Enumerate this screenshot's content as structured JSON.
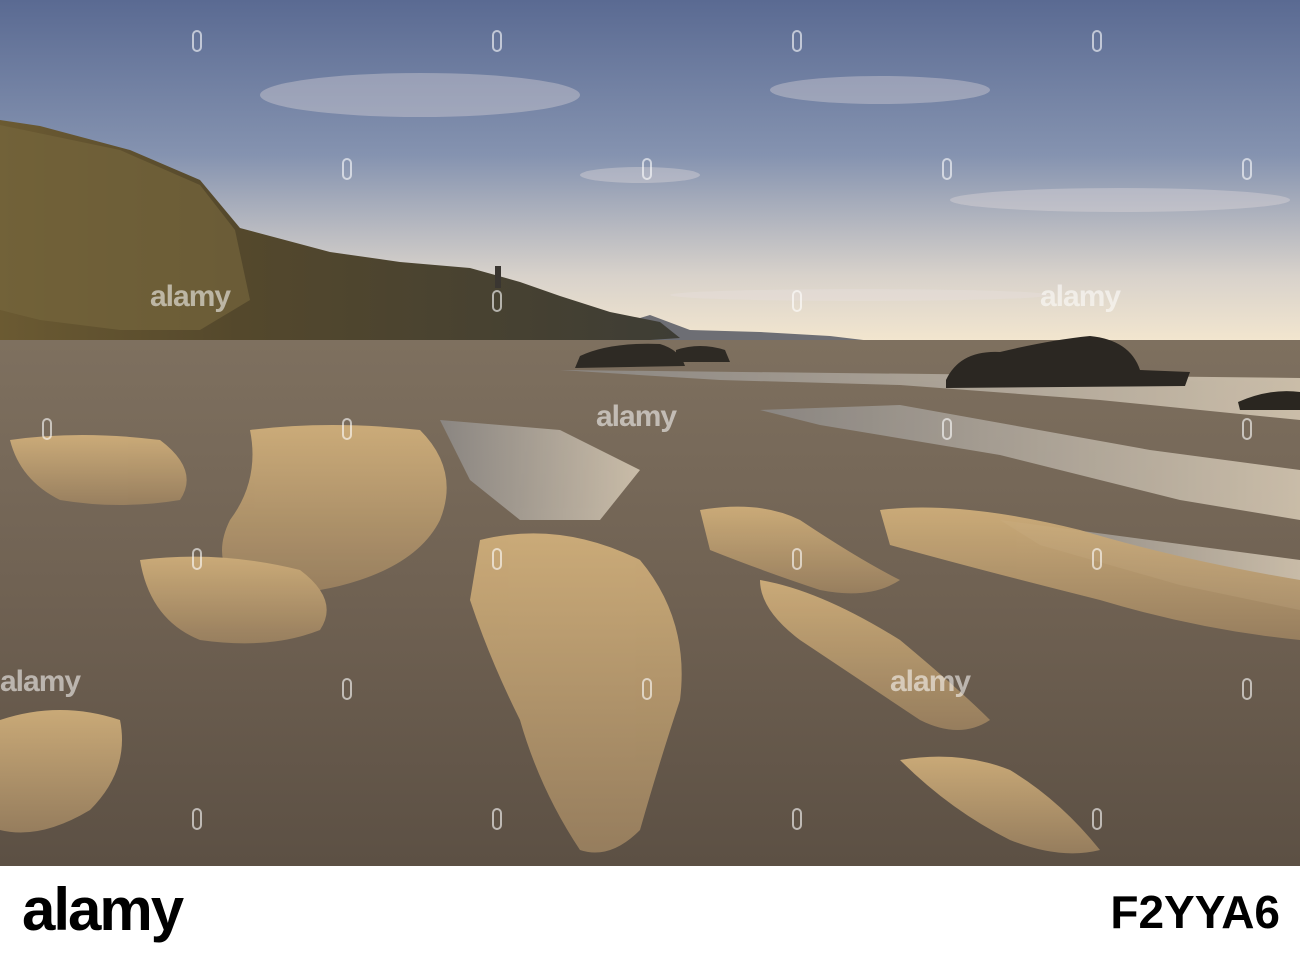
{
  "photo": {
    "subject": "",
    "sky_color": "#6f7fa3",
    "horizon_color": "#f3e6cc",
    "sand_color": "#8c7a62",
    "highlight_color": "#c9a777"
  },
  "watermark": {
    "text": "alamy"
  },
  "footer": {
    "logo": "alamy",
    "image_id": "F2YYA6"
  }
}
